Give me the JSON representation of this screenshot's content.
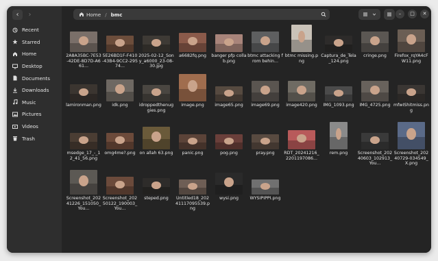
{
  "window": {
    "nav": {
      "back": "‹",
      "forward": "›"
    },
    "path": {
      "home_label": "Home",
      "separator": "/",
      "current": "bmc"
    },
    "controls": {
      "minimize": "–",
      "maximize": "□",
      "close": "✕"
    }
  },
  "sidebar": {
    "items": [
      {
        "label": "Recent",
        "icon": "clock-icon"
      },
      {
        "label": "Starred",
        "icon": "star-icon"
      },
      {
        "label": "Home",
        "icon": "home-icon"
      },
      {
        "label": "Desktop",
        "icon": "desktop-icon"
      },
      {
        "label": "Documents",
        "icon": "documents-icon"
      },
      {
        "label": "Downloads",
        "icon": "download-icon"
      },
      {
        "label": "Music",
        "icon": "music-icon"
      },
      {
        "label": "Pictures",
        "icon": "pictures-icon"
      },
      {
        "label": "Videos",
        "icon": "videos-icon"
      },
      {
        "label": "Trash",
        "icon": "trash-icon"
      }
    ]
  },
  "files": [
    {
      "name": "2A8A35BC-7E53-42DE-8D7D-A661...",
      "color": "#7a6f69"
    },
    {
      "name": "5E26BD1F-F410-43B4-9CC2-29574...",
      "color": "#6c4d3b"
    },
    {
      "name": "2025-02-12_Sony_a6000_23-08-30.jpg",
      "color": "#3e3a35"
    },
    {
      "name": "a6682fq.png",
      "color": "#8a5a4a"
    },
    {
      "name": "banger pfp collab.png",
      "color": "#a8847a"
    },
    {
      "name": "btmc attacking from behin...",
      "color": "#5e5f60"
    },
    {
      "name": "btmc missing.png",
      "color": "#c9c2b8"
    },
    {
      "name": "Captura_de_Tela_124.png",
      "color": "#2d2b2a"
    },
    {
      "name": "cringe.png",
      "color": "#5b5753"
    },
    {
      "name": "Firefox_rqYA4cFW11.png",
      "color": "#6b5e54"
    },
    {
      "name": "lamironman.png",
      "color": "#3b3530"
    },
    {
      "name": "idk.png",
      "color": "#6e6862"
    },
    {
      "name": "idroppedthenuggies.png",
      "color": "#4a4641"
    },
    {
      "name": "image.png",
      "color": "#a06d4e"
    },
    {
      "name": "image65.png",
      "color": "#564a40"
    },
    {
      "name": "image69.png",
      "color": "#5a5550"
    },
    {
      "name": "image420.png",
      "color": "#6f6b63"
    },
    {
      "name": "IMG_1093.png",
      "color": "#4b4b4b"
    },
    {
      "name": "IMG_4725.png",
      "color": "#68625c"
    },
    {
      "name": "mfwIShitmiss.png",
      "color": "#3a3633"
    },
    {
      "name": "msedge_17_-_12_41_56.png",
      "color": "#4a3d33"
    },
    {
      "name": "omg4me?.png",
      "color": "#6c4a3a"
    },
    {
      "name": "on allah 63.png",
      "color": "#6a5a3a"
    },
    {
      "name": "panic.png",
      "color": "#5b4338"
    },
    {
      "name": "pog.png",
      "color": "#6a3f3a"
    },
    {
      "name": "pray.png",
      "color": "#584a40"
    },
    {
      "name": "RDT_20241216_2201197086...",
      "color": "#b85a5a"
    },
    {
      "name": "rem.png",
      "color": "#8a8a8a"
    },
    {
      "name": "Screenshot_20240603_102913_You...",
      "color": "#3a3a3a"
    },
    {
      "name": "Screenshot_20240729-034549_X.png",
      "color": "#5a6a88"
    },
    {
      "name": "Screenshot_20241226_151050_You...",
      "color": "#5c5954"
    },
    {
      "name": "Screenshot_20250122_190003_You...",
      "color": "#6b4a3b"
    },
    {
      "name": "steped.png",
      "color": "#2e2c2a"
    },
    {
      "name": "Untitled18_20241117095539.png",
      "color": "#6e5e55"
    },
    {
      "name": "wysi.png",
      "color": "#2a2a2a"
    },
    {
      "name": "WYSIPIPPI.png",
      "color": "#707070"
    }
  ]
}
